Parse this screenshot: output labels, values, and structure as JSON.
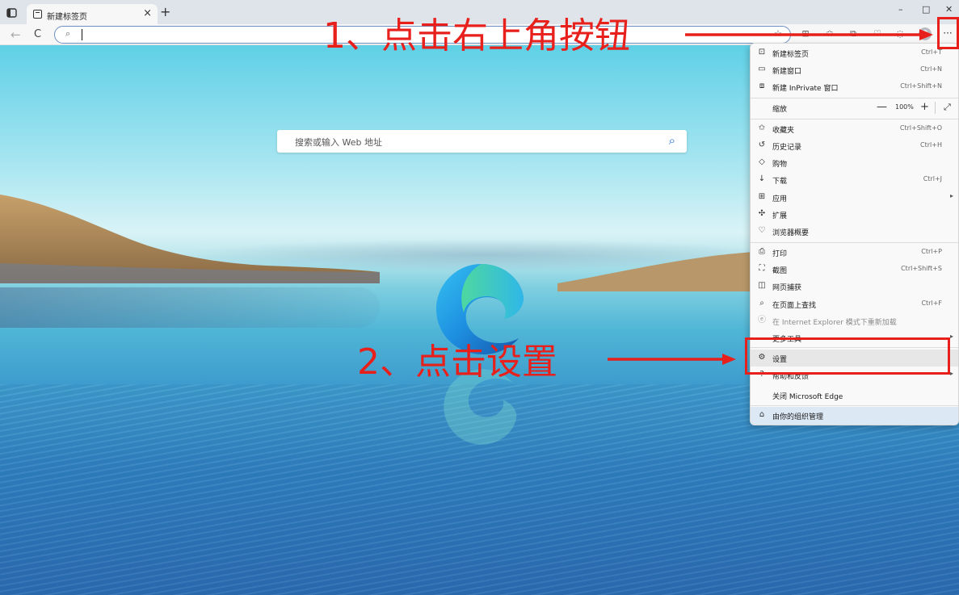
{
  "tab": {
    "title": "新建标签页",
    "close": "×",
    "new": "+"
  },
  "window_controls": {
    "minimize": "–",
    "maximize": "□",
    "close": "✕"
  },
  "toolbar": {
    "back": "←",
    "refresh": "C",
    "search_icon": "⌕",
    "more": "···"
  },
  "ntp": {
    "search_placeholder": "搜索或输入 Web 地址",
    "search_icon": "⌕"
  },
  "menu": {
    "new_tab": {
      "label": "新建标签页",
      "shortcut": "Ctrl+T"
    },
    "new_window": {
      "label": "新建窗口",
      "shortcut": "Ctrl+N"
    },
    "new_inprivate": {
      "label": "新建 InPrivate 窗口",
      "shortcut": "Ctrl+Shift+N"
    },
    "zoom": {
      "label": "缩放",
      "minus": "—",
      "value": "100%",
      "plus": "+",
      "fullscreen": "⤢"
    },
    "favorites": {
      "label": "收藏夹",
      "shortcut": "Ctrl+Shift+O"
    },
    "history": {
      "label": "历史记录",
      "shortcut": "Ctrl+H"
    },
    "shopping": {
      "label": "购物"
    },
    "downloads": {
      "label": "下载",
      "shortcut": "Ctrl+J"
    },
    "apps": {
      "label": "应用",
      "arrow": "▸"
    },
    "extensions": {
      "label": "扩展"
    },
    "browser_essentials": {
      "label": "浏览器概要"
    },
    "print": {
      "label": "打印",
      "shortcut": "Ctrl+P"
    },
    "screenshot": {
      "label": "截图",
      "shortcut": "Ctrl+Shift+S"
    },
    "web_capture": {
      "label": "网页捕获"
    },
    "find": {
      "label": "在页面上查找",
      "shortcut": "Ctrl+F"
    },
    "ie_mode": {
      "label": "在 Internet Explorer 模式下重新加载"
    },
    "more_tools": {
      "label": "更多工具",
      "arrow": "▸"
    },
    "settings": {
      "label": "设置"
    },
    "help": {
      "label": "帮助和反馈",
      "arrow": "▸"
    },
    "close_edge": {
      "label": "关闭 Microsoft Edge"
    },
    "org": {
      "label": "由你的组织管理"
    }
  },
  "annotations": {
    "step1": "1、点击右上角按钮",
    "step2": "2、点击设置",
    "color": "#e8201c"
  }
}
